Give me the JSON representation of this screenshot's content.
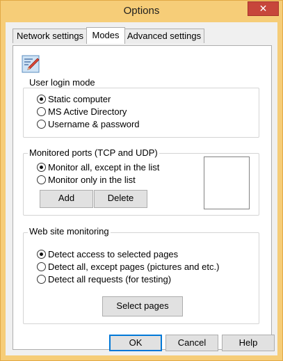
{
  "window": {
    "title": "Options",
    "close_glyph": "✕"
  },
  "tabs": [
    {
      "label": "Network settings",
      "active": false
    },
    {
      "label": "Modes",
      "active": true
    },
    {
      "label": "Advanced settings",
      "active": false
    }
  ],
  "logo": {
    "icon": "pen-document-icon"
  },
  "login_mode": {
    "title": "User login mode",
    "options": [
      {
        "label": "Static computer",
        "checked": true
      },
      {
        "label": "MS Active Directory",
        "checked": false
      },
      {
        "label": "Username & password",
        "checked": false
      }
    ]
  },
  "ports": {
    "title": "Monitored ports (TCP and UDP)",
    "options": [
      {
        "label": "Monitor all, except in the list",
        "checked": true
      },
      {
        "label": "Monitor only in the list",
        "checked": false
      }
    ],
    "add_label": "Add",
    "delete_label": "Delete"
  },
  "web": {
    "title": "Web site monitoring",
    "options": [
      {
        "label": "Detect access to selected pages",
        "checked": true
      },
      {
        "label": "Detect all, except pages (pictures and etc.)",
        "checked": false
      },
      {
        "label": "Detect all requests (for testing)",
        "checked": false
      }
    ],
    "select_label": "Select pages"
  },
  "footer": {
    "ok_label": "OK",
    "cancel_label": "Cancel",
    "help_label": "Help"
  }
}
